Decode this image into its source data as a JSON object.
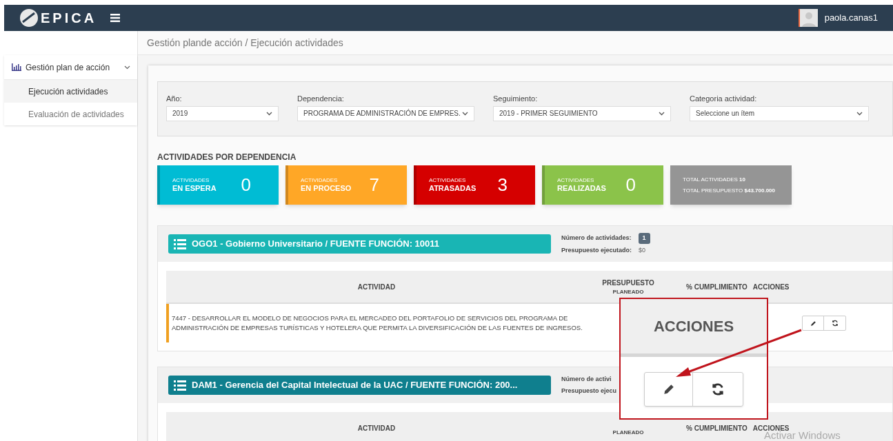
{
  "header": {
    "logo": "EPICA",
    "user": "paola.canas1"
  },
  "breadcrumb": "Gestión plande acción / Ejecución actividades",
  "sidebar": {
    "group": {
      "label": "Gestión plan de acción",
      "expanded": true,
      "children": [
        {
          "label": "Ejecución actividades",
          "selected": true
        },
        {
          "label": "Evaluación de actividades",
          "selected": false
        }
      ]
    }
  },
  "filters": [
    {
      "label": "Año:",
      "value": "2019"
    },
    {
      "label": "Dependencia:",
      "value": "PROGRAMA DE ADMINISTRACIÓN DE EMPRES."
    },
    {
      "label": "Seguimiento:",
      "value": "2019 - PRIMER SEGUIMIENTO"
    },
    {
      "label": "Categoria actividad:",
      "value": "Seleccione un ítem"
    }
  ],
  "summary": {
    "title": "ACTIVIDADES POR DEPENDENCIA",
    "cards": [
      {
        "kind": "count",
        "top": "ACTIVIDADES",
        "bottom": "EN ESPERA",
        "value": "0",
        "color": "#00bcd4"
      },
      {
        "kind": "count",
        "top": "ACTIVIDADES",
        "bottom": "EN PROCESO",
        "value": "7",
        "color": "#ffa726"
      },
      {
        "kind": "count",
        "top": "ACTIVIDADES",
        "bottom": "ATRASADAS",
        "value": "3",
        "color": "#d50000"
      },
      {
        "kind": "count",
        "top": "ACTIVIDADES",
        "bottom": "REALIZADAS",
        "value": "0",
        "color": "#8bc34a"
      },
      {
        "kind": "total",
        "lines": [
          "TOTAL ACTIVIDADES **10**",
          "TOTAL PRESUPUESTO **$43.700.000**"
        ],
        "color": "#959595"
      }
    ]
  },
  "groups": [
    {
      "title": "OGO1 - Gobierno Universitario / FUENTE FUNCIÓN: 10011",
      "color": "#19b5b4",
      "count_label": "Número de actividades:",
      "count": "1",
      "budget_label": "Presupuesto ejecutado:",
      "budget": "$0",
      "columns": [
        "ACTIVIDAD",
        "PRESUPUESTO",
        "PLANEADO",
        "% CUMPLIMIENTO",
        "ACCIONES"
      ],
      "rows": [
        {
          "text": "7447 - DESARROLLAR EL MODELO DE NEGOCIOS  PARA EL MERCADEO DEL PORTAFOLIO DE SERVICIOS DEL PROGRAMA DE ADMINISTRACIÓN DE EMPRESAS TURÍSTICAS Y HOTELERA QUE PERMITA LA DIVERSIFICACIÓN DE LAS FUENTES DE INGRESOS."
        }
      ]
    },
    {
      "title": "DAM1 - Gerencia del Capital Intelectual de la UAC / FUENTE FUNCIÓN: 200...",
      "color": "#0f7f8e",
      "count_label": "Número de activi",
      "budget_label": "Presupuesto ejecu",
      "columns": [
        "ACTIVIDAD",
        "PLANEADO",
        "% CUMPLIMIENTO",
        "ACCIONES"
      ]
    }
  ],
  "callout": {
    "title": "ACCIONES"
  },
  "os_notice": "Activar Windows"
}
